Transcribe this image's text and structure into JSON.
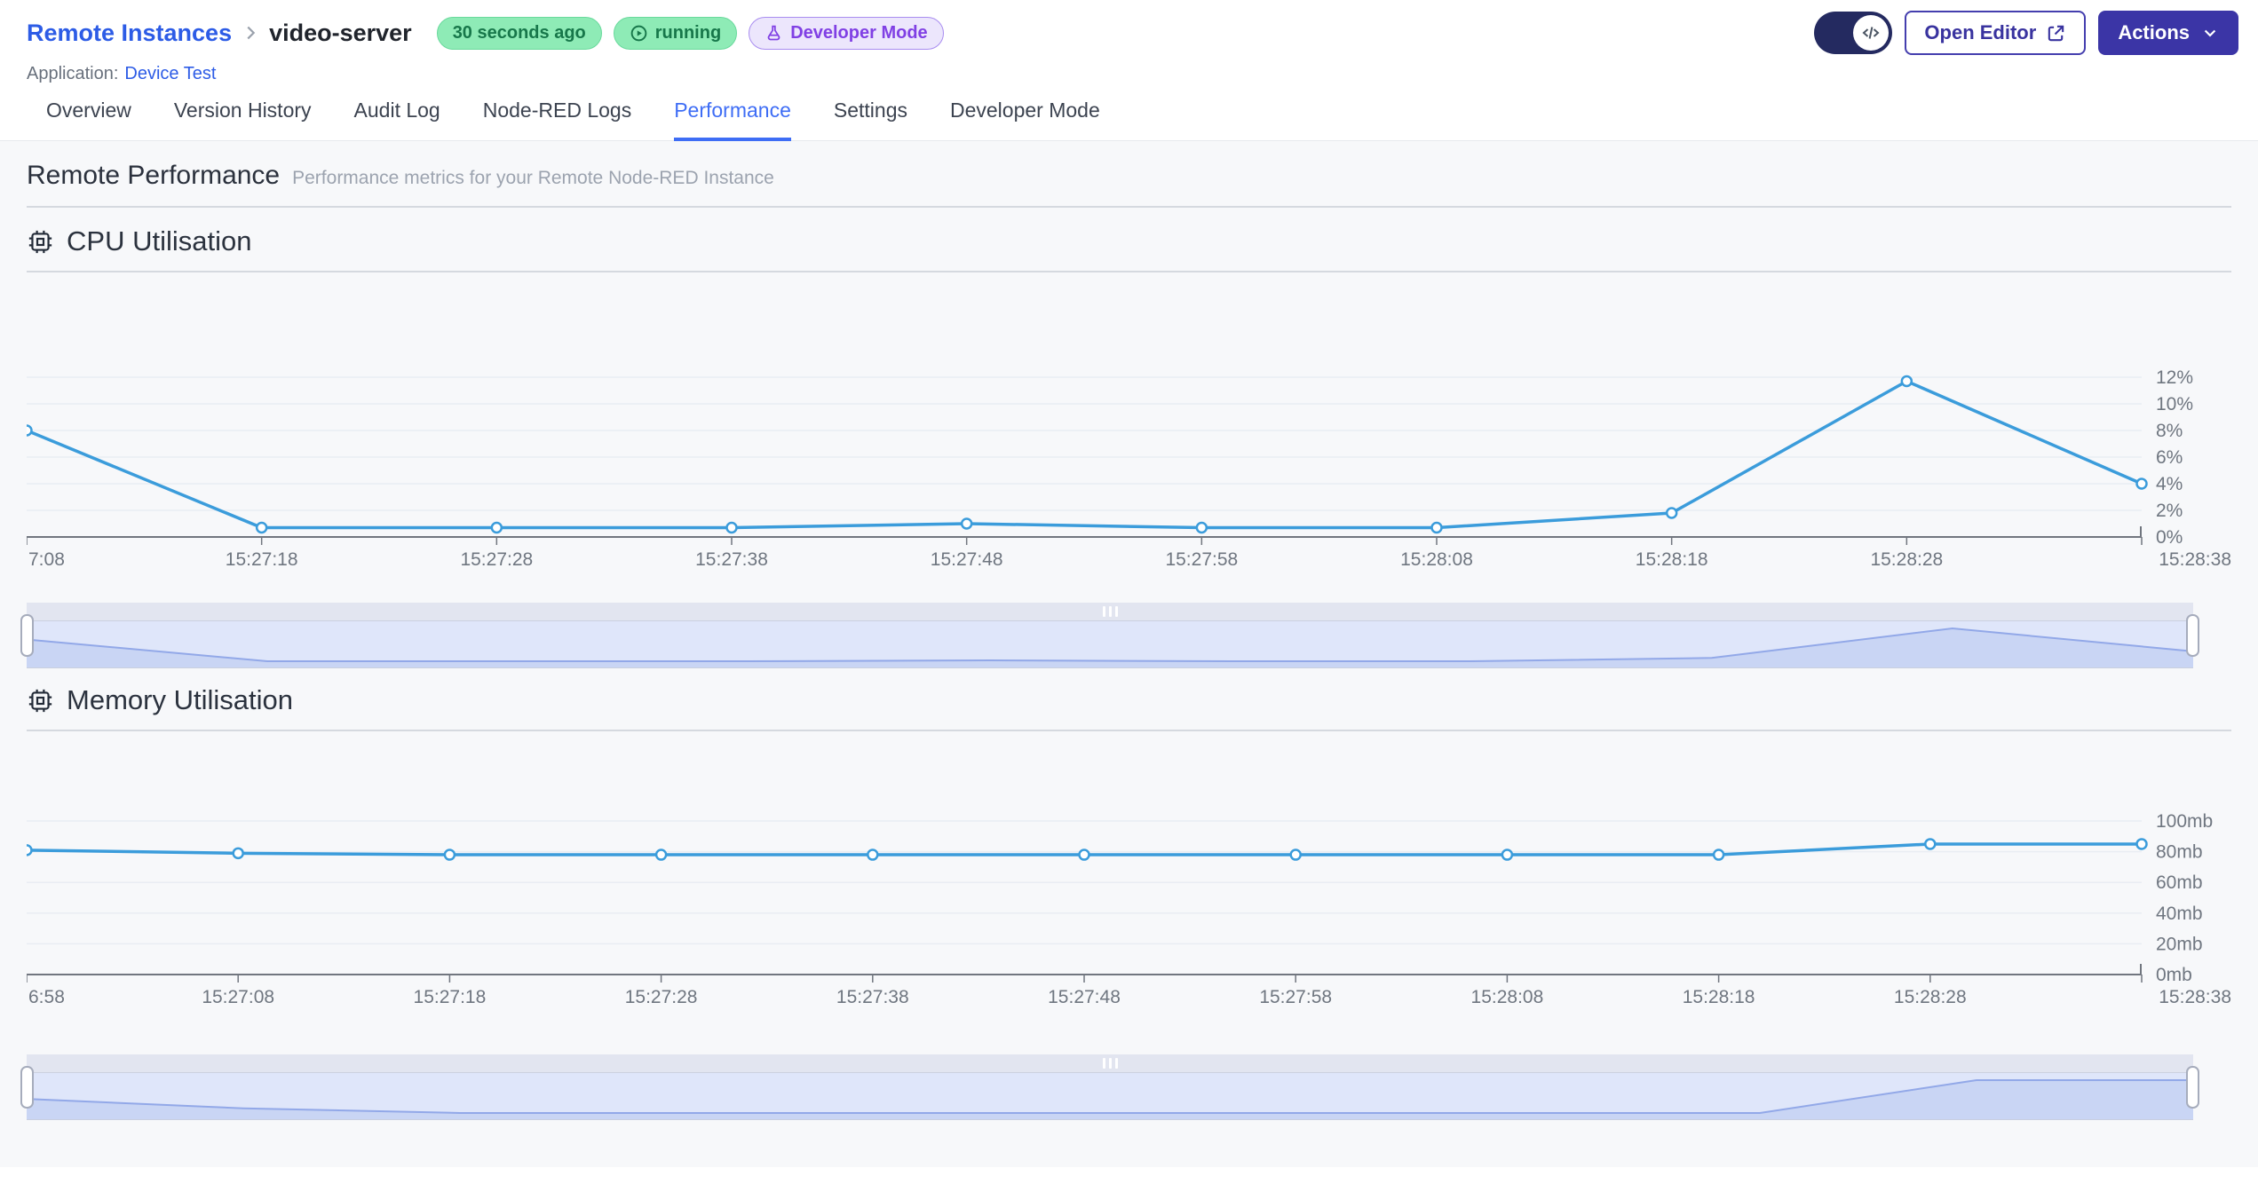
{
  "header": {
    "breadcrumb": {
      "parent": "Remote Instances",
      "current": "video-server"
    },
    "badges": {
      "last_seen": "30 seconds ago",
      "status": "running",
      "mode": "Developer Mode"
    },
    "application": {
      "label": "Application:",
      "name": "Device Test"
    },
    "buttons": {
      "open_editor": "Open Editor",
      "actions": "Actions"
    }
  },
  "tabs": [
    {
      "label": "Overview",
      "active": false
    },
    {
      "label": "Version History",
      "active": false
    },
    {
      "label": "Audit Log",
      "active": false
    },
    {
      "label": "Node-RED Logs",
      "active": false
    },
    {
      "label": "Performance",
      "active": true
    },
    {
      "label": "Settings",
      "active": false
    },
    {
      "label": "Developer Mode",
      "active": false
    }
  ],
  "page": {
    "title": "Remote Performance",
    "subtitle": "Performance metrics for your Remote Node-RED Instance"
  },
  "sections": {
    "cpu": {
      "title": "CPU Utilisation"
    },
    "memory": {
      "title": "Memory Utilisation"
    }
  },
  "colors": {
    "accent_blue": "#3E6DF5",
    "link_blue": "#2D5CE6",
    "line_blue": "#3B9CDB",
    "badge_green_bg": "#8EEBB6",
    "badge_green_text": "#17774A",
    "badge_purple_bg": "#ECE6FC",
    "badge_purple_text": "#8040E4",
    "button_indigo": "#3B35A6",
    "toggle_navy": "#242A60"
  },
  "chart_data": [
    {
      "type": "line",
      "title": "CPU Utilisation",
      "unit": "%",
      "line_color": "#3B9CDB",
      "grid": true,
      "y_axis_position": "right",
      "x_labels": [
        "7:08",
        "15:27:18",
        "15:27:28",
        "15:27:38",
        "15:27:48",
        "15:27:58",
        "15:28:08",
        "15:28:18",
        "15:28:28",
        "15:28:38"
      ],
      "values": [
        8,
        0.7,
        0.7,
        0.7,
        1,
        0.7,
        0.7,
        1.8,
        11.7,
        4
      ],
      "y_ticks": [
        0,
        2,
        4,
        6,
        8,
        10,
        12
      ],
      "y_tick_labels": [
        "0%",
        "2%",
        "4%",
        "6%",
        "8%",
        "10%",
        "12%"
      ],
      "ylim": [
        0,
        12
      ]
    },
    {
      "type": "line",
      "title": "Memory Utilisation",
      "unit": "mb",
      "line_color": "#3B9CDB",
      "grid": true,
      "y_axis_position": "right",
      "x_labels": [
        "6:58",
        "15:27:08",
        "15:27:18",
        "15:27:28",
        "15:27:38",
        "15:27:48",
        "15:27:58",
        "15:28:08",
        "15:28:18",
        "15:28:28",
        "15:28:38"
      ],
      "values": [
        81,
        79,
        78,
        78,
        78,
        78,
        78,
        78,
        78,
        85,
        85
      ],
      "y_ticks": [
        0,
        20,
        40,
        60,
        80,
        100
      ],
      "y_tick_labels": [
        "0mb",
        "20mb",
        "40mb",
        "60mb",
        "80mb",
        "100mb"
      ],
      "ylim": [
        0,
        100
      ]
    }
  ]
}
